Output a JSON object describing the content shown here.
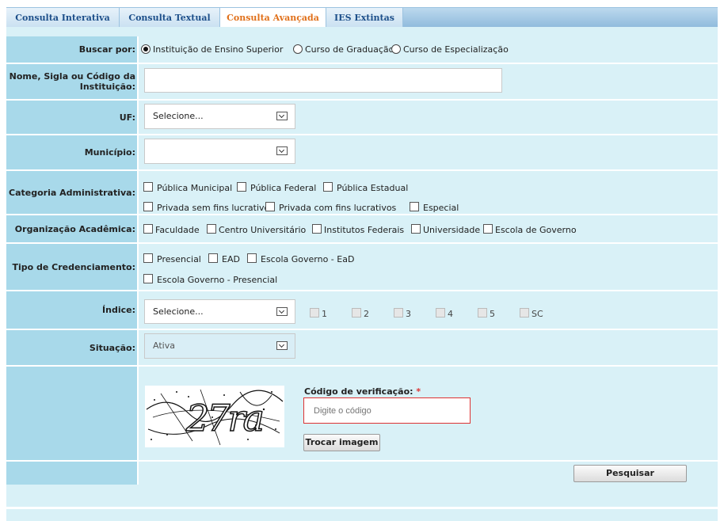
{
  "tabs": [
    {
      "label": "Consulta Interativa",
      "active": false
    },
    {
      "label": "Consulta Textual",
      "active": false
    },
    {
      "label": "Consulta Avançada",
      "active": true
    },
    {
      "label": "IES Extintas",
      "active": false
    }
  ],
  "form": {
    "buscar_por": {
      "label": "Buscar por:",
      "options": [
        "Instituição de Ensino Superior",
        "Curso de Graduação",
        "Curso de Especialização"
      ],
      "selected": "Instituição de Ensino Superior"
    },
    "nome": {
      "label": "Nome, Sigla ou Código da Instituição:",
      "value": ""
    },
    "uf": {
      "label": "UF:",
      "value": "Selecione..."
    },
    "municipio": {
      "label": "Município:",
      "value": ""
    },
    "categoria": {
      "label": "Categoria Administrativa:",
      "options": [
        "Pública Municipal",
        "Pública Federal",
        "Pública Estadual",
        "Privada sem fins lucrativos",
        "Privada com fins lucrativos",
        "Especial"
      ]
    },
    "organizacao": {
      "label": "Organização Acadêmica:",
      "options": [
        "Faculdade",
        "Centro Universitário",
        "Institutos Federais",
        "Universidade",
        "Escola de Governo"
      ]
    },
    "credenciamento": {
      "label": "Tipo de Credenciamento:",
      "options": [
        "Presencial",
        "EAD",
        "Escola Governo - EaD",
        "Escola Governo - Presencial"
      ]
    },
    "indice": {
      "label": "Índice:",
      "value": "Selecione...",
      "options": [
        "1",
        "2",
        "3",
        "4",
        "5",
        "SC"
      ]
    },
    "situacao": {
      "label": "Situação:",
      "value": "Ativa"
    },
    "captcha": {
      "label": "Código de verificação:",
      "required_mark": "*",
      "placeholder": "Digite o código",
      "image_text": "27ra",
      "trocar_label": "Trocar imagem"
    },
    "pesquisar_label": "Pesquisar"
  },
  "colors": {
    "label_bg": "#a8d9ea",
    "panel_bg": "#d9f1f7",
    "tab_active_text": "#e0701a",
    "tab_text": "#1d4f8a",
    "required": "#d33"
  }
}
